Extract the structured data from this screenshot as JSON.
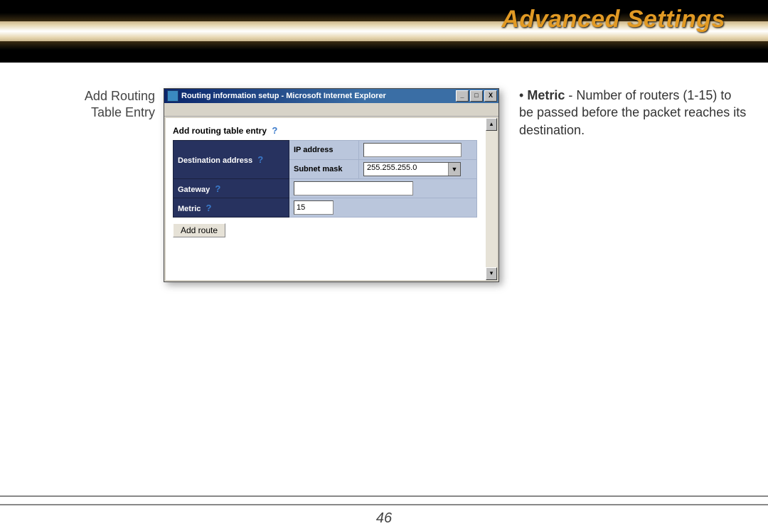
{
  "header": {
    "title": "Advanced Settings"
  },
  "page_number": "46",
  "left_caption": {
    "line1": "Add Routing",
    "line2": "Table Entry"
  },
  "right_desc": {
    "bullet": "•",
    "term": "Metric",
    "sep": " - ",
    "body": "Number of routers (1-15) to be passed before the packet reaches its destination."
  },
  "ie_window": {
    "titlebar": "Routing information setup - Microsoft Internet Explorer",
    "win_buttons": {
      "min": "_",
      "max": "□",
      "close": "X"
    },
    "content": {
      "section_title": "Add routing table entry",
      "help_glyph": "?",
      "rows": {
        "dest_addr": {
          "label": "Destination address",
          "ip_label": "IP address",
          "ip_value": "",
          "mask_label": "Subnet mask",
          "mask_value": "255.255.255.0"
        },
        "gateway": {
          "label": "Gateway",
          "value": ""
        },
        "metric": {
          "label": "Metric",
          "value": "15"
        }
      },
      "add_button": "Add route"
    }
  }
}
